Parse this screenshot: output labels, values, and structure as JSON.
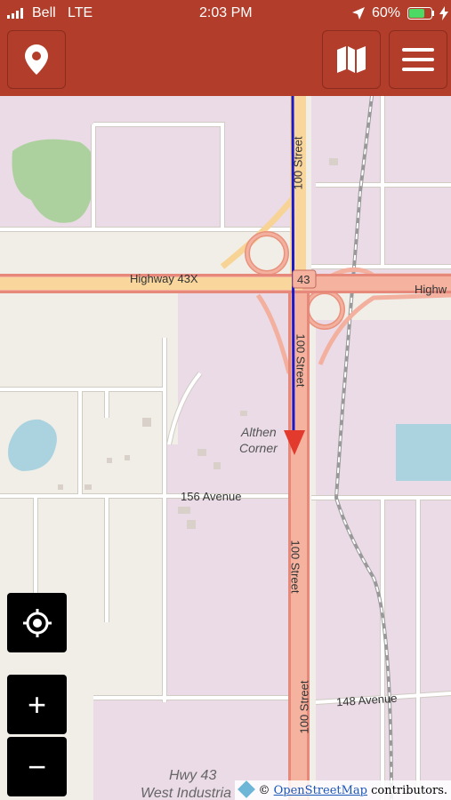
{
  "status_bar": {
    "carrier": "Bell",
    "network": "LTE",
    "time": "2:03 PM",
    "battery": "60%"
  },
  "toolbar": {
    "left_icon": "location-pin-icon",
    "right_icons": [
      "map-icon",
      "menu-icon"
    ]
  },
  "map": {
    "labels": {
      "highway_west": "Highway 43X",
      "highway_east": "Highw",
      "shield": "43",
      "street_top": "100 Street",
      "street_mid": "100 Street",
      "street_lower": "100 Street",
      "street_bottom": "100 Street",
      "place_line1": "Althen",
      "place_line2": "Corner",
      "avenue_156": "156 Avenue",
      "avenue_148": "148 Avenue",
      "industrial_line1": "Hwy 43",
      "industrial_line2": "West Industria"
    },
    "route_color": "#1a1acc",
    "marker_color": "#e23b2e"
  },
  "controls": {
    "locate": "crosshair-icon",
    "zoom_in": "+",
    "zoom_out": "−"
  },
  "attribution": {
    "prefix": "©",
    "link": "OpenStreetMap",
    "suffix": "contributors."
  }
}
